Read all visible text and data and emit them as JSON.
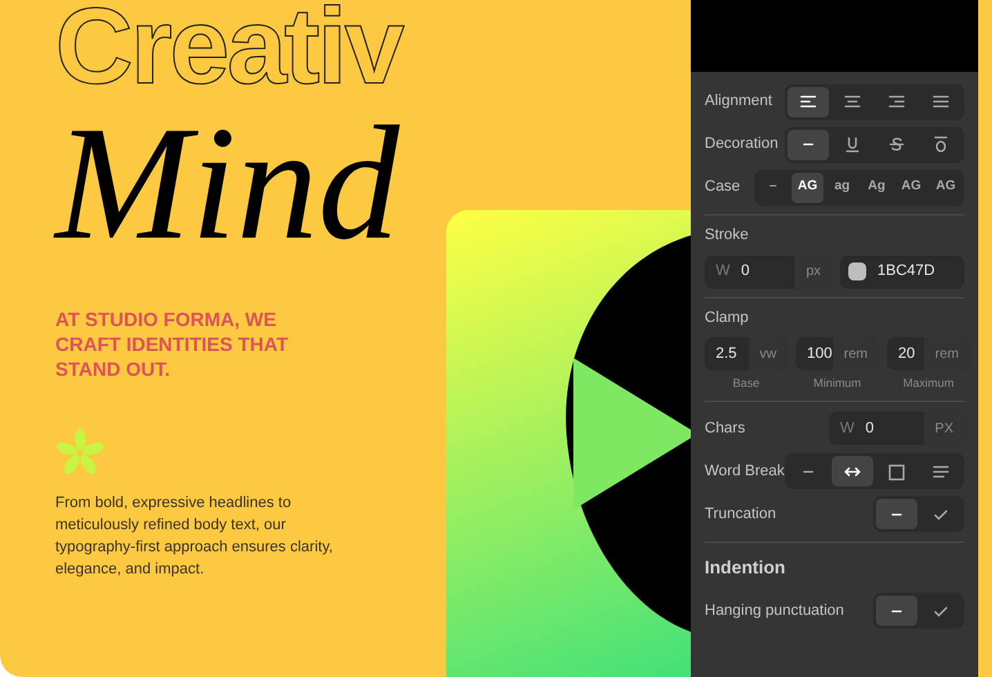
{
  "poster": {
    "outline_word": "Creativ",
    "script_word": "Mind",
    "tagline": "AT STUDIO FORMA, WE CRAFT IDENTITIES THAT STAND OUT.",
    "body": "From bold, expressive headlines to meticulously refined body text, our typography-first approach ensures clarity, elegance, and impact."
  },
  "panel": {
    "rows": [
      {
        "kind": "icons",
        "label": "Alignment",
        "options": [
          {
            "kind": "align-left",
            "selected": true
          },
          {
            "kind": "align-center",
            "selected": false
          },
          {
            "kind": "align-right",
            "selected": false
          },
          {
            "kind": "justify",
            "selected": false
          }
        ]
      },
      {
        "kind": "icons",
        "label": "Decoration",
        "options": [
          {
            "kind": "dash",
            "selected": true
          },
          {
            "kind": "underline",
            "selected": false
          },
          {
            "kind": "strike",
            "selected": false
          },
          {
            "kind": "overline",
            "selected": false
          }
        ]
      },
      {
        "kind": "texts",
        "label": "Case",
        "options": [
          {
            "label": "–",
            "selected": false
          },
          {
            "label": "AG",
            "selected": true
          },
          {
            "label": "ag",
            "selected": false
          },
          {
            "label": "Ag",
            "selected": false
          },
          {
            "label": "AG",
            "selected": false
          },
          {
            "label": "AG",
            "selected": false
          }
        ]
      },
      {
        "kind": "divider"
      },
      {
        "kind": "stroke",
        "label": "Stroke",
        "prefix": "W",
        "value": "0",
        "unit": "px",
        "hex": "1BC47D"
      },
      {
        "kind": "divider"
      },
      {
        "kind": "clamp",
        "label": "Clamp",
        "fields": [
          {
            "value": "2.5",
            "unit": "vw",
            "caption": "Base"
          },
          {
            "value": "100",
            "unit": "rem",
            "caption": "Minimum"
          },
          {
            "value": "20",
            "unit": "rem",
            "caption": "Maximum"
          }
        ]
      },
      {
        "kind": "divider"
      },
      {
        "kind": "chars",
        "label": "Chars",
        "prefix": "W",
        "value": "0",
        "unit": "PX"
      },
      {
        "kind": "icons",
        "label": "Word Break",
        "options": [
          {
            "kind": "dash",
            "selected": false
          },
          {
            "kind": "arrows",
            "selected": true
          },
          {
            "kind": "square",
            "selected": false
          },
          {
            "kind": "lines",
            "selected": false
          }
        ]
      },
      {
        "kind": "icons",
        "label": "Truncation",
        "options": [
          {
            "kind": "dash",
            "selected": true
          },
          {
            "kind": "check",
            "selected": false
          }
        ]
      },
      {
        "kind": "divider"
      },
      {
        "kind": "heading",
        "label": "Indention"
      },
      {
        "kind": "icons",
        "label": "Hanging punctuation",
        "options": [
          {
            "kind": "dash",
            "selected": true
          },
          {
            "kind": "check",
            "selected": false
          }
        ]
      }
    ]
  }
}
